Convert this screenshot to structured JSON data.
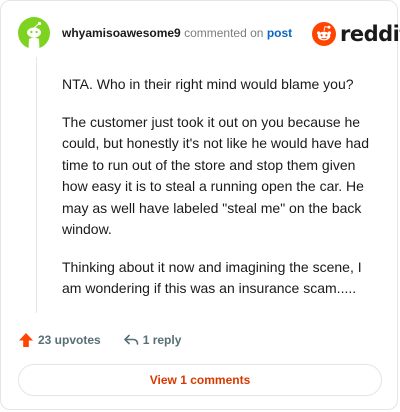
{
  "comment": {
    "username": "whyamisoawesome9",
    "commented_on": "commented on",
    "post_link": "post",
    "paragraphs": [
      "NTA. Who in their right mind would blame you?",
      "The customer just took it out on you because he could, but honestly it's not like he would have had time to run out of the store and stop them given how easy it is to steal a running open the car. He may as well have labeled \"steal me\" on the back window.",
      "Thinking about it now and imagining the scene, I am wondering if this was an insurance scam....."
    ]
  },
  "brand": {
    "wordmark": "reddit",
    "color": "#ff4500"
  },
  "actions": {
    "upvotes": "23 upvotes",
    "reply": "1 reply",
    "view_comments": "View 1 comments"
  },
  "colors": {
    "accent": "#ff4500",
    "link": "#0a66c2",
    "view_button_text": "#d93900",
    "avatar": "#7ed321"
  },
  "icons": {
    "avatar": "snoo-avatar-icon",
    "logo": "reddit-snoo-icon",
    "upvote": "upvote-arrow-icon",
    "reply": "reply-arrow-icon"
  }
}
